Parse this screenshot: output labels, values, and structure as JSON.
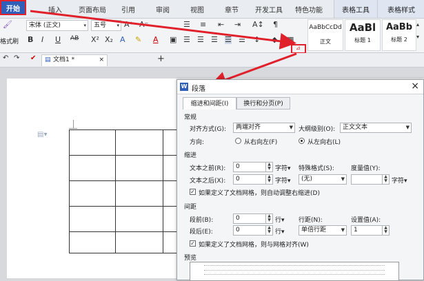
{
  "menu": {
    "start": "开始",
    "items": [
      "插入",
      "页面布局",
      "引用",
      "审阅",
      "视图",
      "章节",
      "开发工具",
      "特色功能"
    ],
    "context_tabs": [
      "表格工具",
      "表格样式"
    ]
  },
  "ribbon": {
    "left_label": "格式刷",
    "font_name": "宋体 (正文)",
    "font_size": "五号",
    "styles": [
      {
        "preview": "AaBbCcDd",
        "name": "正文"
      },
      {
        "preview": "AaBl",
        "name": "标题 1"
      },
      {
        "preview": "AaBb",
        "name": "标题 2"
      }
    ]
  },
  "tabbar": {
    "doc_name": "文档1 *",
    "add": "+"
  },
  "dialog": {
    "title": "段落",
    "close": "×",
    "tabs": [
      "缩进和间距(I)",
      "换行和分页(P)"
    ],
    "general": {
      "section": "常规",
      "align_label": "对齐方式(G):",
      "align_value": "两端对齐",
      "outline_label": "大纲级别(O):",
      "outline_value": "正文文本",
      "direction_label": "方向:",
      "rtl": "从右向左(F)",
      "ltr": "从左向右(L)"
    },
    "indent": {
      "section": "缩进",
      "before_label": "文本之前(R):",
      "before_value": "0",
      "before_unit": "字符▾",
      "special_label": "特殊格式(S):",
      "special_value": "(无)",
      "amount_label": "度量值(Y):",
      "amount_value": "",
      "amount_unit": "字符▾",
      "after_label": "文本之后(X):",
      "after_value": "0",
      "after_unit": "字符▾",
      "auto_check": "如果定义了文档网格，则自动调整右缩进(D)"
    },
    "spacing": {
      "section": "间距",
      "before_label": "段前(B):",
      "before_value": "0",
      "before_unit": "行▾",
      "line_label": "行距(N):",
      "line_value": "单倍行距",
      "set_label": "设置值(A):",
      "set_value": "1",
      "after_label": "段后(E):",
      "after_value": "0",
      "after_unit": "行▾",
      "grid_check": "如果定义了文档网格，则与网格对齐(W)"
    },
    "preview": {
      "section": "预览"
    }
  },
  "colors": {
    "accent": "#2f5fb8",
    "annotation": "#e0202a"
  }
}
